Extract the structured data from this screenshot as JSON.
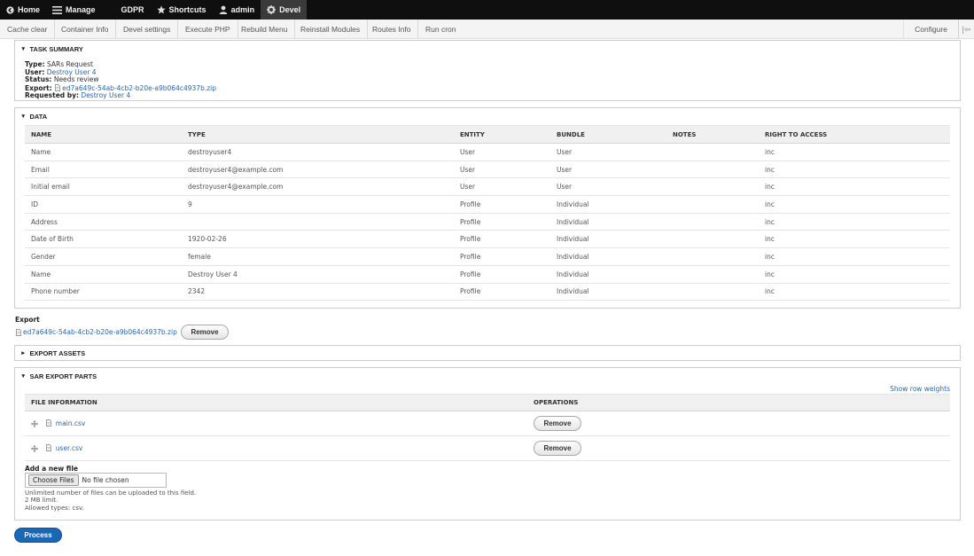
{
  "toolbar": {
    "items": [
      {
        "label": "Home",
        "icon": "back-arrow-icon"
      },
      {
        "label": "Manage",
        "icon": "hamburger-icon"
      },
      {
        "label": "GDPR"
      },
      {
        "label": "Shortcuts",
        "icon": "star-icon"
      },
      {
        "label": "admin",
        "icon": "user-icon"
      },
      {
        "label": "Devel",
        "icon": "gear-icon"
      }
    ]
  },
  "tray": {
    "items": [
      "Cache clear",
      "Container Info",
      "Devel settings",
      "Execute PHP",
      "Rebuild Menu",
      "Reinstall Modules",
      "Routes Info",
      "Run cron"
    ],
    "configure": "Configure",
    "toggle": "|⇦"
  },
  "task_summary": {
    "title": "Task Summary",
    "type_label": "Type:",
    "type_value": "SARs Request",
    "user_label": "User:",
    "user_value": "Destroy User 4",
    "status_label": "Status:",
    "status_value": "Needs review",
    "export_label": "Export:",
    "export_value": "ed7a649c-54ab-4cb2-b20e-a9b064c4937b.zip",
    "requested_label": "Requested by:",
    "requested_value": "Destroy User 4"
  },
  "data": {
    "title": "Data",
    "columns": [
      "Name",
      "Type",
      "Entity",
      "Bundle",
      "Notes",
      "Right to Access"
    ],
    "rows": [
      [
        "Name",
        "destroyuser4",
        "User",
        "User",
        "",
        "inc"
      ],
      [
        "Email",
        "destroyuser4@example.com",
        "User",
        "User",
        "",
        "inc"
      ],
      [
        "Initial email",
        "destroyuser4@example.com",
        "User",
        "User",
        "",
        "inc"
      ],
      [
        "ID",
        "9",
        "Profile",
        "Individual",
        "",
        "inc"
      ],
      [
        "Address",
        "",
        "Profile",
        "Individual",
        "",
        "inc"
      ],
      [
        "Date of Birth",
        "1920-02-26",
        "Profile",
        "Individual",
        "",
        "inc"
      ],
      [
        "Gender",
        "female",
        "Profile",
        "Individual",
        "",
        "inc"
      ],
      [
        "Name",
        "Destroy User 4",
        "Profile",
        "Individual",
        "",
        "inc"
      ],
      [
        "Phone number",
        "2342",
        "Profile",
        "Individual",
        "",
        "inc"
      ]
    ]
  },
  "export": {
    "label": "Export",
    "file": "ed7a649c-54ab-4cb2-b20e-a9b064c4937b.zip",
    "remove_label": "Remove"
  },
  "export_assets": {
    "title": "Export Assets"
  },
  "sar_parts": {
    "title": "SAR Export Parts",
    "show_weights": "Show row weights",
    "columns": [
      "File information",
      "Operations"
    ],
    "rows": [
      {
        "file": "main.csv",
        "remove_label": "Remove"
      },
      {
        "file": "user.csv",
        "remove_label": "Remove"
      }
    ],
    "add_label": "Add a new file",
    "choose_label": "Choose Files",
    "no_file": "No file chosen",
    "help1": "Unlimited number of files can be uploaded to this field.",
    "help2": "2 MB limit.",
    "help3": "Allowed types: csv."
  },
  "process_label": "Process"
}
